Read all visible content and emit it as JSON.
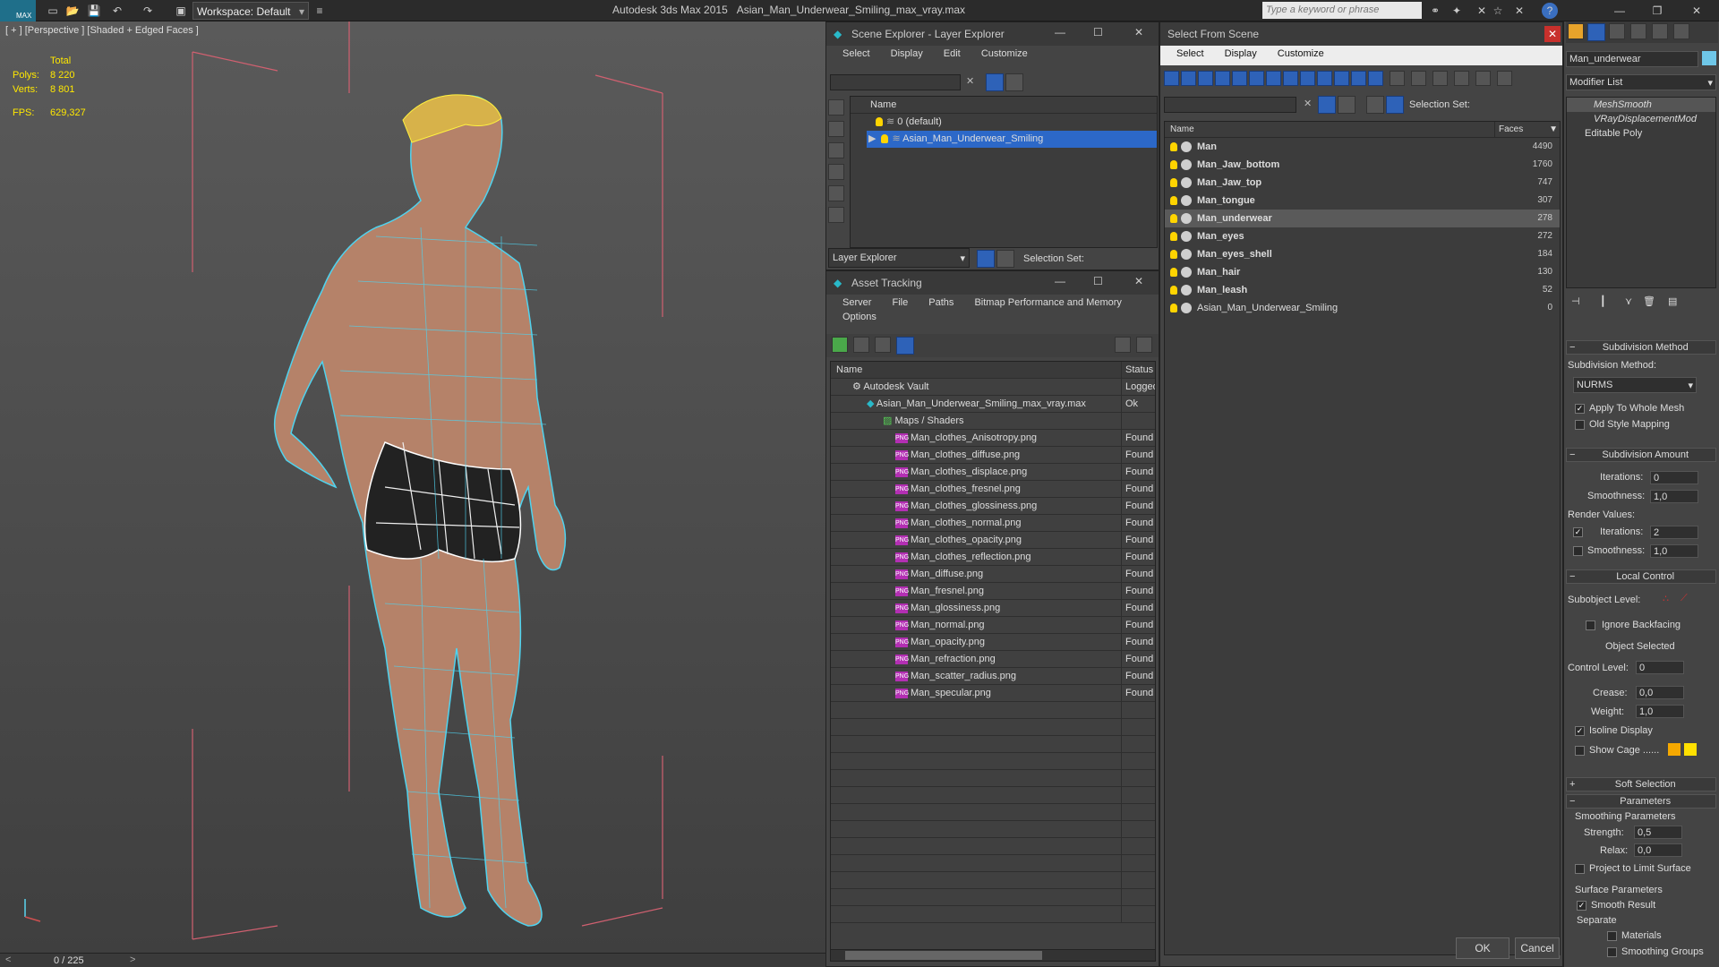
{
  "app": {
    "title": "Autodesk 3ds Max  2015",
    "file": "Asian_Man_Underwear_Smiling_max_vray.max",
    "workspace": "Workspace: Default",
    "search_placeholder": "Type a keyword or phrase",
    "logo": "MAX"
  },
  "viewport": {
    "label": "[ + ] [Perspective ] [Shaded + Edged Faces ]",
    "total_label": "Total",
    "polys_label": "Polys:",
    "polys_value": "8 220",
    "verts_label": "Verts:",
    "verts_value": "8 801",
    "fps_label": "FPS:",
    "fps_value": "629,327",
    "frame": "0 / 225"
  },
  "scene_explorer": {
    "title": "Scene Explorer - Layer Explorer",
    "menu": [
      "Select",
      "Display",
      "Edit",
      "Customize"
    ],
    "column": "Name",
    "layers": [
      "0 (default)",
      "Asian_Man_Underwear_Smiling"
    ],
    "footer_label": "Layer Explorer",
    "selection_set": "Selection Set:"
  },
  "asset_tracking": {
    "title": "Asset Tracking",
    "menu": [
      "Server",
      "File",
      "Paths",
      "Bitmap Performance and Memory"
    ],
    "menu2": "Options",
    "col_name": "Name",
    "col_status": "Status",
    "vault": "Autodesk Vault",
    "vault_status": "Logged",
    "file": "Asian_Man_Underwear_Smiling_max_vray.max",
    "file_status": "Ok",
    "maps": "Maps / Shaders",
    "found": "Found",
    "files": [
      "Man_clothes_Anisotropy.png",
      "Man_clothes_diffuse.png",
      "Man_clothes_displace.png",
      "Man_clothes_fresnel.png",
      "Man_clothes_glossiness.png",
      "Man_clothes_normal.png",
      "Man_clothes_opacity.png",
      "Man_clothes_reflection.png",
      "Man_diffuse.png",
      "Man_fresnel.png",
      "Man_glossiness.png",
      "Man_normal.png",
      "Man_opacity.png",
      "Man_refraction.png",
      "Man_scatter_radius.png",
      "Man_specular.png"
    ],
    "png_badge": "PNG"
  },
  "select_from_scene": {
    "title": "Select From Scene",
    "menu": [
      "Select",
      "Display",
      "Customize"
    ],
    "selection_set": "Selection Set:",
    "col_name": "Name",
    "col_faces": "Faces",
    "objects": [
      {
        "name": "Man",
        "faces": "4490"
      },
      {
        "name": "Man_Jaw_bottom",
        "faces": "1760"
      },
      {
        "name": "Man_Jaw_top",
        "faces": "747"
      },
      {
        "name": "Man_tongue",
        "faces": "307"
      },
      {
        "name": "Man_underwear",
        "faces": "278"
      },
      {
        "name": "Man_eyes",
        "faces": "272"
      },
      {
        "name": "Man_eyes_shell",
        "faces": "184"
      },
      {
        "name": "Man_hair",
        "faces": "130"
      },
      {
        "name": "Man_leash",
        "faces": "52"
      },
      {
        "name": "Asian_Man_Underwear_Smiling",
        "faces": "0"
      }
    ],
    "ok": "OK",
    "cancel": "Cancel"
  },
  "command_panel": {
    "object_name": "Man_underwear",
    "modifier_list": "Modifier List",
    "stack": [
      "MeshSmooth",
      "VRayDisplacementMod",
      "Editable Poly"
    ],
    "subdivision_method_rollout": "Subdivision Method",
    "subdivision_method_label": "Subdivision Method:",
    "subdivision_method_value": "NURMS",
    "apply_whole_mesh": "Apply To Whole Mesh",
    "old_style_mapping": "Old Style Mapping",
    "subdivision_amount_rollout": "Subdivision Amount",
    "iterations_label": "Iterations:",
    "iterations_value": "0",
    "smoothness_label": "Smoothness:",
    "smoothness_value": "1,0",
    "render_values": "Render Values:",
    "render_iterations_value": "2",
    "render_smoothness_value": "1,0",
    "local_control_rollout": "Local Control",
    "subobject_level": "Subobject Level:",
    "ignore_backfacing": "Ignore Backfacing",
    "object_selected": "Object Selected",
    "control_level_label": "Control Level:",
    "control_level_value": "0",
    "crease_label": "Crease:",
    "crease_value": "0,0",
    "weight_label": "Weight:",
    "weight_value": "1,0",
    "isoline_display": "Isoline Display",
    "show_cage": "Show Cage ......",
    "soft_selection_rollout": "Soft Selection",
    "parameters_rollout": "Parameters",
    "smoothing_parameters": "Smoothing Parameters",
    "strength_label": "Strength:",
    "strength_value": "0,5",
    "relax_label": "Relax:",
    "relax_value": "0,0",
    "project_limit": "Project to Limit Surface",
    "surface_parameters": "Surface Parameters",
    "smooth_result": "Smooth Result",
    "separate": "Separate",
    "materials": "Materials",
    "smoothing_groups": "Smoothing Groups"
  }
}
